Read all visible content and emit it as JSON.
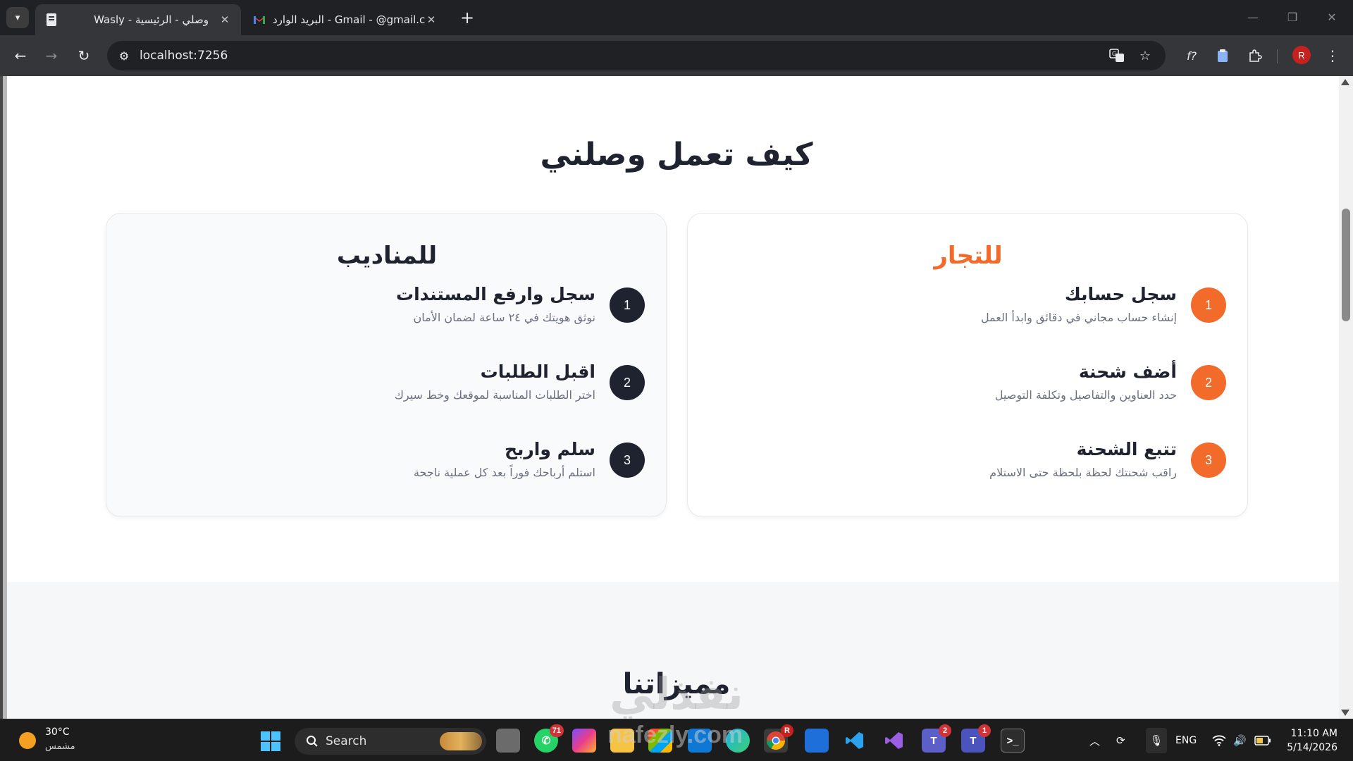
{
  "browser": {
    "tabs": [
      {
        "title": "Wasly - وصلي - الرئيسية",
        "active": true
      },
      {
        "title": "البريد الوارد - Gmail - @gmail.com",
        "active": false
      }
    ],
    "url": "localhost:7256",
    "profile_initial": "R"
  },
  "page": {
    "how_it_works_title": "كيف تعمل وصلني",
    "merchants": {
      "title": "للتجار",
      "accent": "#f26b2a",
      "steps": [
        {
          "num": "1",
          "title": "سجل حسابك",
          "desc": "إنشاء حساب مجاني في دقائق وابدأ العمل"
        },
        {
          "num": "2",
          "title": "أضف شحنة",
          "desc": "حدد العناوين والتفاصيل وتكلفة التوصيل"
        },
        {
          "num": "3",
          "title": "تتبع الشحنة",
          "desc": "راقب شحنتك لحظة بلحظة حتى الاستلام"
        }
      ]
    },
    "drivers": {
      "title": "للمناديب",
      "accent": "#1f2330",
      "steps": [
        {
          "num": "1",
          "title": "سجل وارفع المستندات",
          "desc": "نوثق هويتك في ٢٤ ساعة لضمان الأمان"
        },
        {
          "num": "2",
          "title": "اقبل الطلبات",
          "desc": "اختر الطلبات المناسبة لموقعك وخط سيرك"
        },
        {
          "num": "3",
          "title": "سلم واربح",
          "desc": "استلم أرباحك فوراً بعد كل عملية ناجحة"
        }
      ]
    },
    "features_title": "مميزاتنا"
  },
  "watermark": {
    "ar": "نفذلي",
    "en": "nafezly.com"
  },
  "taskbar": {
    "weather_temp": "30°C",
    "weather_desc": "مشمس",
    "search_label": "Search",
    "whatsapp_badge": "71",
    "teams_badge": "2",
    "teams2_badge": "1",
    "chrome_badge": "R",
    "lang": "ENG",
    "time": "11:10 AM",
    "date": "5/14/2026"
  }
}
